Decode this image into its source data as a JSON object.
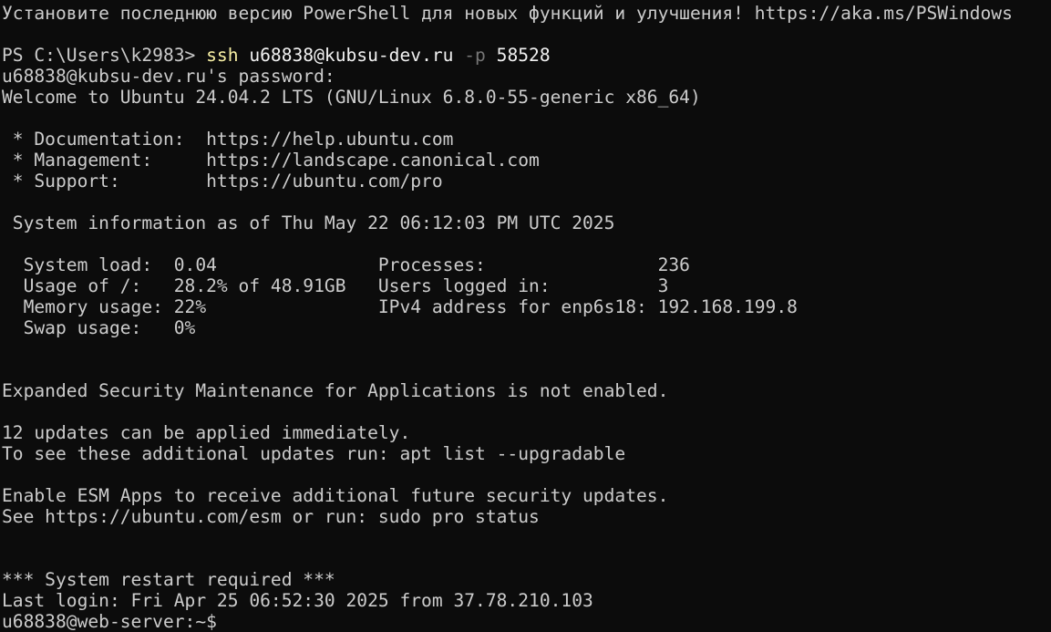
{
  "terminal": {
    "banner": "Установите последнюю версию PowerShell для новых функций и улучшения! https://aka.ms/PSWindows",
    "prompt_ps": "PS C:\\Users\\k2983> ",
    "command": "ssh",
    "command_arg1": " u68838@kubsu-dev.ru ",
    "command_param": "-p",
    "command_arg2": " 58528",
    "password_prompt": "u68838@kubsu-dev.ru's password:",
    "welcome": "Welcome to Ubuntu 24.04.2 LTS (GNU/Linux 6.8.0-55-generic x86_64)",
    "doc_line": " * Documentation:  https://help.ubuntu.com",
    "mgmt_line": " * Management:     https://landscape.canonical.com",
    "support_line": " * Support:        https://ubuntu.com/pro",
    "sysinfo_header": " System information as of Thu May 22 06:12:03 PM UTC 2025",
    "sys_row1": "  System load:  0.04               Processes:                236",
    "sys_row2": "  Usage of /:   28.2% of 48.91GB   Users logged in:          3",
    "sys_row3": "  Memory usage: 22%                IPv4 address for enp6s18: 192.168.199.8",
    "sys_row4": "  Swap usage:   0%",
    "esm_line": "Expanded Security Maintenance for Applications is not enabled.",
    "updates_line1": "12 updates can be applied immediately.",
    "updates_line2": "To see these additional updates run: apt list --upgradable",
    "esm_apps_line1": "Enable ESM Apps to receive additional future security updates.",
    "esm_apps_line2": "See https://ubuntu.com/esm or run: sudo pro status",
    "restart_line": "*** System restart required ***",
    "last_login": "Last login: Fri Apr 25 06:52:30 2025 from 37.78.210.103",
    "final_prompt": "u68838@web-server:~$"
  }
}
